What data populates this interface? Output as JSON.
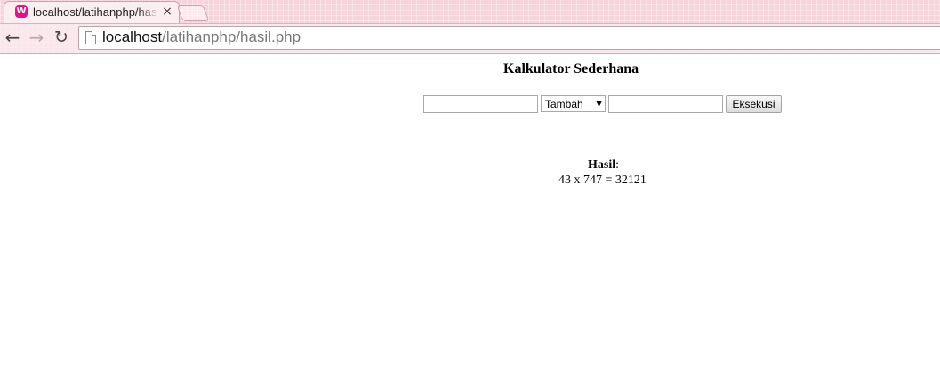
{
  "browser": {
    "tab": {
      "favicon_glyph": "W",
      "favicon_color": "#e0138a",
      "title": "localhost/latihanphp/hasil.php",
      "close_glyph": "×"
    },
    "nav": {
      "back_glyph": "←",
      "forward_glyph": "→",
      "reload_glyph": "↻"
    },
    "address": {
      "host": "localhost",
      "path": "/latihanphp/hasil.php"
    }
  },
  "page": {
    "title": "Kalkulator Sederhana",
    "form": {
      "number1_value": "",
      "operation_selected": "Tambah",
      "operation_arrow": "▼",
      "number2_value": "",
      "execute_label": "Eksekusi"
    },
    "result": {
      "label": "Hasil",
      "separator": ":",
      "expression": "43 x 747 = 32121"
    }
  }
}
